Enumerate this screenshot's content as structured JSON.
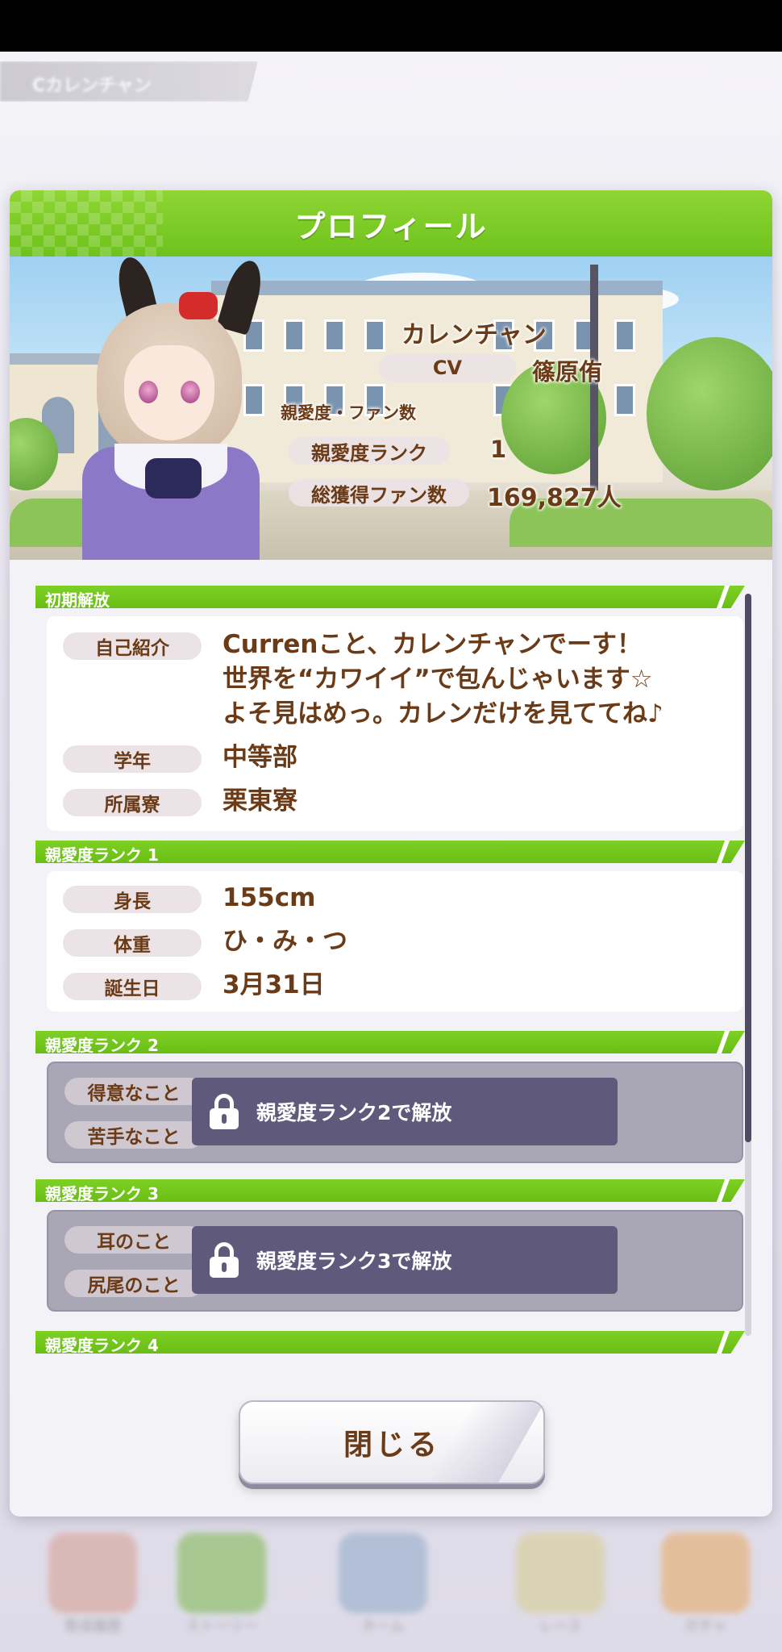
{
  "background": {
    "tab_label": "Сカレンチャン"
  },
  "dialog": {
    "title": "プロフィール",
    "character": {
      "name": "カレンチャン",
      "cv_label": "CV",
      "cv_value": "篠原侑",
      "section_label": "親愛度・ファン数",
      "rank_label": "親愛度ランク",
      "rank_value": "1",
      "fans_label": "総獲得ファン数",
      "fans_value": "169,827人"
    },
    "sections": [
      {
        "header": "初期解放",
        "rows": [
          {
            "label": "自己紹介",
            "lines": [
              "Currenこと、カレンチャンでーす！",
              "世界を“カワイイ”で包んじゃいます☆",
              "よそ見はめっ。カレンだけを見ててね♪"
            ]
          },
          {
            "label": "学年",
            "value": "中等部"
          },
          {
            "label": "所属寮",
            "value": "栗東寮"
          }
        ]
      },
      {
        "header": "親愛度ランク 1",
        "rows": [
          {
            "label": "身長",
            "value": "155cm"
          },
          {
            "label": "体重",
            "value": "ひ・み・つ"
          },
          {
            "label": "誕生日",
            "value": "3月31日"
          }
        ]
      },
      {
        "header": "親愛度ランク 2",
        "locked_labels": [
          "得意なこと",
          "苦手なこと"
        ],
        "lock_text": "親愛度ランク2で解放"
      },
      {
        "header": "親愛度ランク 3",
        "locked_labels": [
          "耳のこと",
          "尻尾のこと"
        ],
        "lock_text": "親愛度ランク3で解放"
      },
      {
        "header": "親愛度ランク 4"
      }
    ],
    "close_label": "閉じる"
  },
  "bottom_nav": [
    "育成履歴",
    "ストーリー",
    "ホーム",
    "レース",
    "ガチャ"
  ],
  "colors": {
    "accent_green": "#6ec21c",
    "text_brown": "#6b3b17",
    "lock_banner": "#5f5a7c",
    "locked_card": "#a9a6b6"
  },
  "icons": [
    "lock-icon"
  ]
}
